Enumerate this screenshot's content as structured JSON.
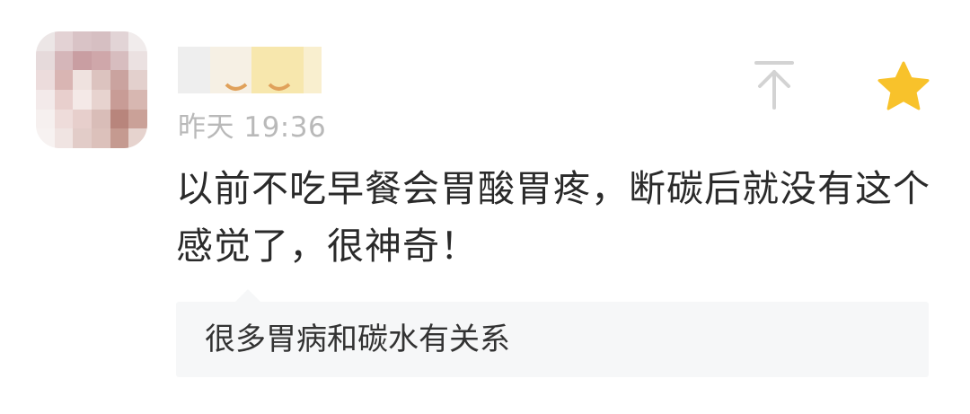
{
  "comment": {
    "timestamp": "昨天 19:36",
    "content": "以前不吃早餐会胃酸胃疼，断碳后就没有这个感觉了，很神奇！",
    "reply": "很多胃病和碳水有关系",
    "avatar_icon": "blurred-avatar",
    "username_icon": "blurred-username",
    "pin_icon": "pin-to-top-icon",
    "favorite_icon": "star-icon",
    "favorite_color": "#f8c22b"
  }
}
